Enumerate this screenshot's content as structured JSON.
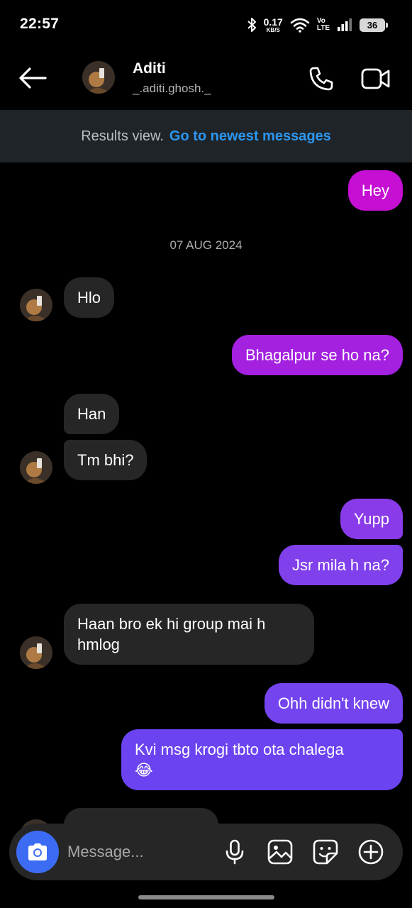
{
  "status_bar": {
    "time": "22:57",
    "net_speed_value": "0.17",
    "net_speed_unit": "KB/S",
    "volte_top": "Vo",
    "volte_bottom": "LTE",
    "battery": "36"
  },
  "header": {
    "name": "Aditi",
    "handle": "_.aditi.ghosh._"
  },
  "banner": {
    "text": "Results view.",
    "link": "Go to newest messages"
  },
  "messages": [
    {
      "from": "me",
      "text": "Hey"
    },
    {
      "type": "date",
      "text": "07 AUG 2024"
    },
    {
      "from": "them",
      "text": "Hlo"
    },
    {
      "from": "me",
      "text": "Bhagalpur se ho na?"
    },
    {
      "from": "them",
      "text": "Han"
    },
    {
      "from": "them",
      "text": "Tm bhi?"
    },
    {
      "from": "me",
      "text": "Yupp"
    },
    {
      "from": "me",
      "text": "Jsr mila h na?"
    },
    {
      "from": "them",
      "text": "Haan bro ek hi group mai h"
    },
    {
      "from": "them",
      "text": "hmlog"
    },
    {
      "from": "me",
      "text": "Ohh didn't knew"
    },
    {
      "from": "me",
      "text": "Kvi msg krogi tbto ota chalega"
    },
    {
      "from": "me",
      "text": "😂"
    }
  ],
  "composer": {
    "placeholder": "Message..."
  },
  "colors": {
    "background": "#000000",
    "incoming_bubble": "#262626",
    "banner_bg": "#1f2428",
    "link": "#2c97f0",
    "camera_button": "#3d6cf4",
    "gradient_top": "#c50fd3",
    "gradient_mid": "#9733e8",
    "gradient_bottom": "#6b43f0"
  },
  "icons": [
    "back-arrow-icon",
    "phone-icon",
    "video-icon",
    "camera-icon",
    "microphone-icon",
    "gallery-icon",
    "sticker-icon",
    "plus-icon"
  ]
}
